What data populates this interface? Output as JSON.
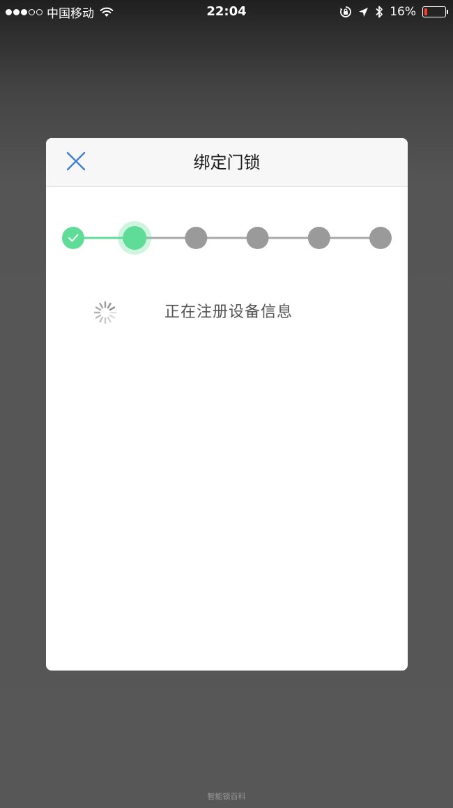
{
  "status_bar": {
    "carrier": "中国移动",
    "time": "22:04",
    "battery_percent": "16%",
    "battery_level": 0.16,
    "signal_filled": 3,
    "signal_total": 5,
    "icons": [
      "wifi-icon",
      "orientation-lock-icon",
      "location-arrow-icon",
      "bluetooth-icon",
      "battery-icon"
    ]
  },
  "modal": {
    "title": "绑定门锁",
    "close_icon": "close-icon",
    "steps": {
      "total": 6,
      "completed": 1,
      "current": 2,
      "colors": {
        "done": "#5fdc97",
        "active": "#5fdc97",
        "pending": "#9a9a9a",
        "line_done": "#5fdc97",
        "line_pending": "#a8a8a8"
      }
    },
    "status_message": "正在注册设备信息",
    "spinner_icon": "loading-spinner-icon"
  },
  "watermark": "智能锁百科"
}
